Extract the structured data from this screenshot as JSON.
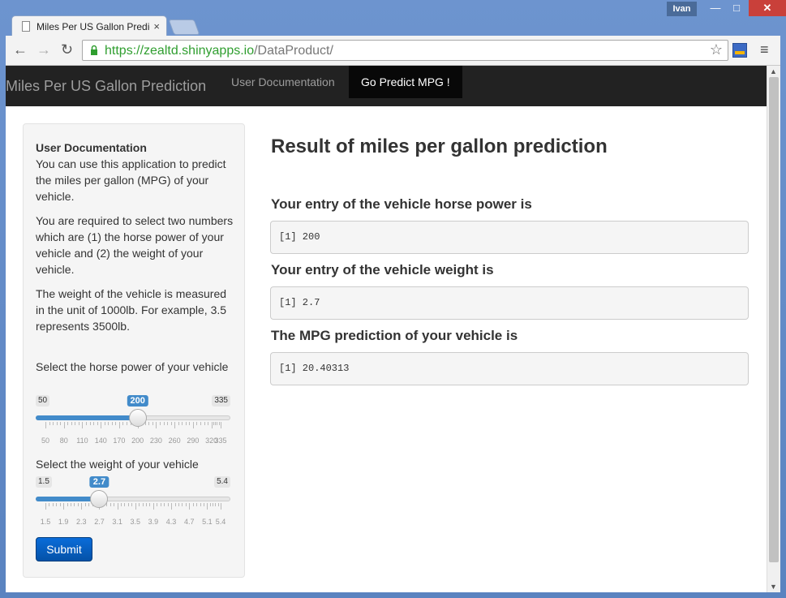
{
  "browser": {
    "tab_title": "Miles Per US Gallon Predic",
    "tab_close": "×",
    "user_name": "Ivan",
    "url_host": "https://zealtd.shinyapps.io",
    "url_path": "/DataProduct/",
    "win_min": "—",
    "win_max": "□",
    "win_close": "✕",
    "back": "←",
    "forward": "→",
    "reload": "↻",
    "star": "☆",
    "menu": "≡"
  },
  "app": {
    "brand": "Miles Per US Gallon Prediction",
    "nav": [
      {
        "label": "User Documentation",
        "active": false
      },
      {
        "label": "Go Predict MPG !",
        "active": true
      }
    ]
  },
  "sidebar": {
    "doc_title": "User Documentation",
    "paragraphs": [
      "You can use this application to predict the miles per gallon (MPG) of your vehicle.",
      "You are required to select two numbers which are (1) the horse power of your vehicle and (2) the weight of your vehicle.",
      "The weight of the vehicle is measured in the unit of 1000lb. For example, 3.5 represents 3500lb."
    ],
    "hp_slider": {
      "label": "Select the horse power of your vehicle",
      "min": 50,
      "max": 335,
      "value": 200,
      "min_label": "50",
      "max_label": "335",
      "value_label": "200",
      "ticks": [
        "50",
        "80",
        "110",
        "140",
        "170",
        "200",
        "230",
        "260",
        "290",
        "320",
        "335"
      ]
    },
    "wt_slider": {
      "label": "Select the weight of your vehicle",
      "min": 1.5,
      "max": 5.4,
      "value": 2.7,
      "min_label": "1.5",
      "max_label": "5.4",
      "value_label": "2.7",
      "ticks": [
        "1.5",
        "1.9",
        "2.3",
        "2.7",
        "3.1",
        "3.5",
        "3.9",
        "4.3",
        "4.7",
        "5.1",
        "5.4"
      ]
    },
    "submit_label": "Submit"
  },
  "main": {
    "title": "Result of miles per gallon prediction",
    "outputs": [
      {
        "label": "Your entry of the vehicle horse power is",
        "value": "[1] 200"
      },
      {
        "label": "Your entry of the vehicle weight is",
        "value": "[1] 2.7"
      },
      {
        "label": "The MPG prediction of your vehicle is",
        "value": "[1] 20.40313"
      }
    ]
  },
  "colors": {
    "navbar_bg": "#222222",
    "accent": "#428bca",
    "submit_bg": "#0a6cd9",
    "url_green": "#2f9e2f"
  }
}
